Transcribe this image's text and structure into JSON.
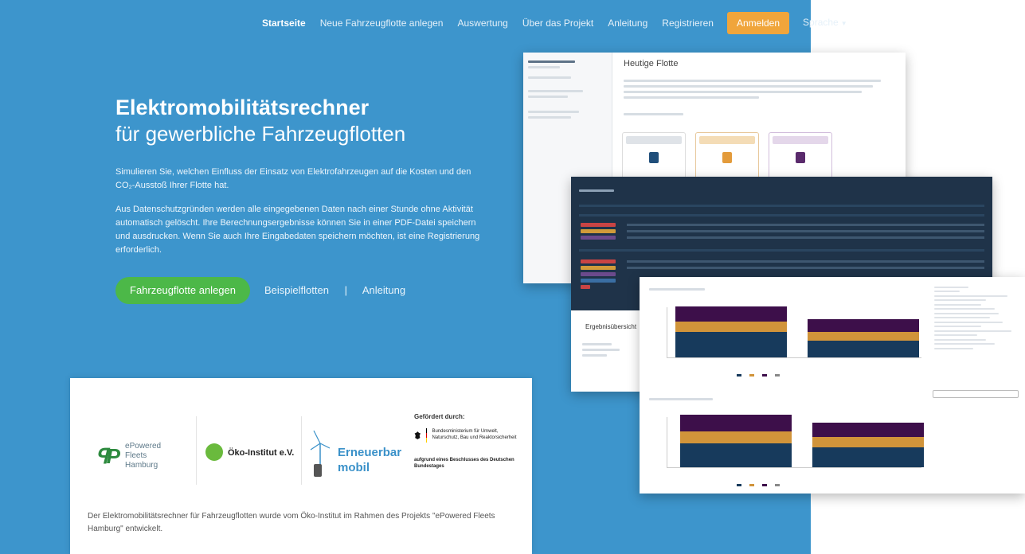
{
  "nav": {
    "items": [
      "Startseite",
      "Neue Fahrzeugflotte anlegen",
      "Auswertung",
      "Über das Projekt",
      "Anleitung",
      "Registrieren"
    ],
    "login": "Anmelden",
    "language": "Sprache"
  },
  "hero": {
    "title": "Elektromobilitätsrechner",
    "subtitle": "für gewerbliche Fahrzeugflotten",
    "paragraph1": "Simulieren Sie, welchen Einfluss der Einsatz von Elektrofahrzeugen auf die Kosten und den CO₂-Ausstoß Ihrer Flotte hat.",
    "paragraph2": "Aus Datenschutzgründen werden alle eingegebenen Daten nach einer Stunde ohne Aktivität automatisch gelöscht. Ihre Berechnungsergebnisse können Sie in einer PDF-Datei speichern und ausdrucken. Wenn Sie auch Ihre Eingabedaten speichern möchten, ist eine Registrierung erforderlich.",
    "cta_primary": "Fahrzeugflotte anlegen",
    "link_examples": "Beispielflotten",
    "link_separator": "|",
    "link_guide": "Anleitung"
  },
  "partners": {
    "epf_name": "ePowered Fleets Hamburg",
    "oeko_name": "Öko-Institut e.V.",
    "em_name": "Erneuerbar mobil",
    "bmu_header": "Gefördert durch:",
    "bmu_ministry": "Bundesministerium für Umwelt, Naturschutz, Bau und Reaktorsicherheit",
    "bmu_beschluss": "aufgrund eines Beschlusses des Deutschen Bundestages",
    "description": "Der Elektromobilitätsrechner für Fahrzeugflotten wurde vom Öko-Institut im Rahmen des Projekts \"ePowered Fleets Hamburg\" entwickelt."
  },
  "screens": {
    "fleet_title": "Heutige Flotte",
    "results_label": "Ergebnisübersicht"
  },
  "colors": {
    "hero_bg": "#3d95cc",
    "cta_green": "#4cb848",
    "login_orange": "#f0a53b",
    "chart_purple": "#3d0f4a",
    "chart_gold": "#d1943a",
    "chart_navy": "#173a5c"
  }
}
